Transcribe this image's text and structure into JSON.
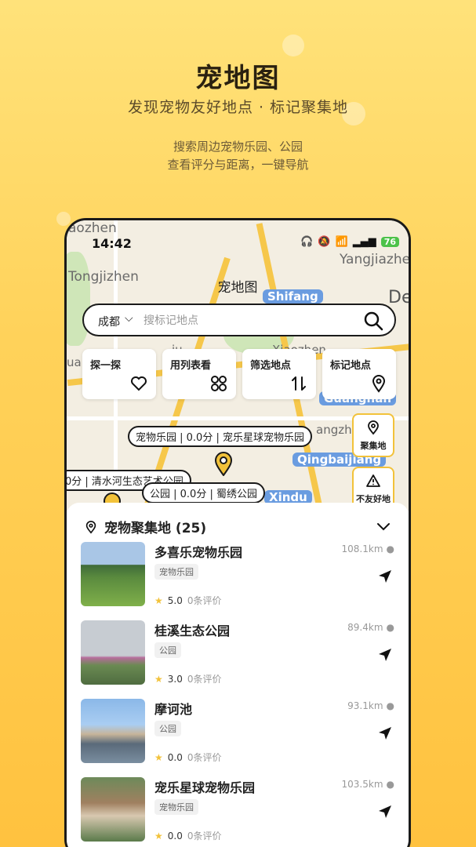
{
  "hero": {
    "title": "宠地图",
    "subtitle": "发现宠物友好地点 · 标记聚集地",
    "desc_line1": "搜索周边宠物乐园、公园",
    "desc_line2": "查看评分与距离，一键导航"
  },
  "status_bar": {
    "time": "14:42",
    "battery": "76"
  },
  "map": {
    "title": "宠地图",
    "place_names": [
      "aozhen",
      "Tongjizhen",
      "Shifang",
      "Yangjiazhe",
      "De",
      "Xiaozhen",
      "Guanghan",
      "Qingbaijiang",
      "Xindu",
      "ua",
      "ju",
      "angzhen"
    ],
    "markers": [
      {
        "label": "宠物乐园 | 0.0分 | 宠乐星球宠物乐园"
      },
      {
        "label": "0分 | 清水河生态艺术公园"
      },
      {
        "label": "公园 | 0.0分 | 蜀绣公园"
      }
    ]
  },
  "search": {
    "city": "成都",
    "placeholder": "搜标记地点"
  },
  "features": [
    {
      "label": "探一探",
      "icon": "heart-icon"
    },
    {
      "label": "用列表看",
      "icon": "grid-icon"
    },
    {
      "label": "筛选地点",
      "icon": "filter-icon"
    },
    {
      "label": "标记地点",
      "icon": "location-pin-icon"
    }
  ],
  "side_buttons": [
    {
      "label": "聚集地",
      "icon": "location-pin-icon"
    },
    {
      "label": "不友好地",
      "icon": "warning-icon"
    }
  ],
  "panel": {
    "title": "宠物聚集地 (25)",
    "places": [
      {
        "name": "多喜乐宠物乐园",
        "tag": "宠物乐园",
        "rating": "5.0",
        "reviews": "0条评价",
        "distance": "108.1km"
      },
      {
        "name": "桂溪生态公园",
        "tag": "公园",
        "rating": "3.0",
        "reviews": "0条评价",
        "distance": "89.4km"
      },
      {
        "name": "摩诃池",
        "tag": "公园",
        "rating": "0.0",
        "reviews": "0条评价",
        "distance": "93.1km"
      },
      {
        "name": "宠乐星球宠物乐园",
        "tag": "宠物乐园",
        "rating": "0.0",
        "reviews": "0条评价",
        "distance": "103.5km"
      }
    ]
  },
  "colors": {
    "accent": "#f2c23a",
    "background": "#ffd25a",
    "text": "#222222"
  }
}
